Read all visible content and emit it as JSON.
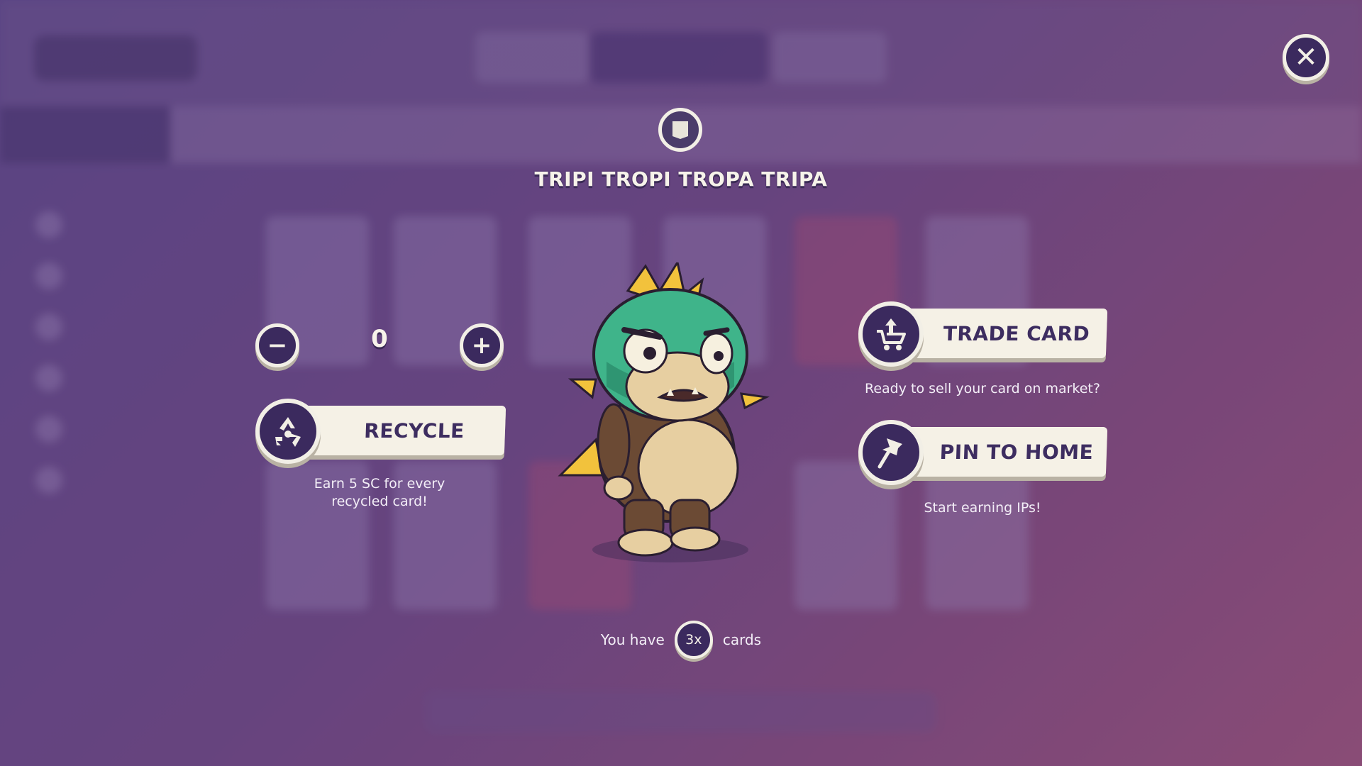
{
  "card": {
    "title": "TRIPI TROPI TROPA TRIPA"
  },
  "recycle": {
    "quantity": "0",
    "minus_symbol": "−",
    "plus_symbol": "+",
    "button_label": "RECYCLE",
    "caption_line1": "Earn 5 SC for every",
    "caption_line2": "recycled card!",
    "icon": "recycle-icon"
  },
  "trade": {
    "button_label": "TRADE CARD",
    "caption": "Ready to sell your card on market?",
    "icon": "cart-icon"
  },
  "pin": {
    "button_label": "PIN  TO HOME",
    "caption": "Start earning IPs!",
    "icon": "pin-icon"
  },
  "ownership": {
    "prefix": "You have",
    "count": "3x",
    "suffix": "cards"
  },
  "close": {
    "symbol": "✕",
    "icon": "close-icon"
  },
  "colors": {
    "button_dark": "#3b2a5e",
    "plate_light": "#f5f1e6",
    "text_dark": "#3d2d60"
  }
}
